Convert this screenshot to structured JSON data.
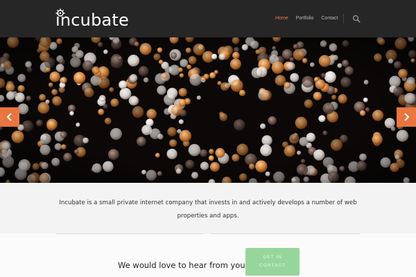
{
  "brand": {
    "name": "incubate"
  },
  "nav": {
    "items": [
      {
        "label": "Home",
        "active": true
      },
      {
        "label": "Portfolio",
        "active": false
      },
      {
        "label": "Contact",
        "active": false
      }
    ],
    "search_icon": "search-icon"
  },
  "hero": {
    "prev_icon": "chevron-left-icon",
    "next_icon": "chevron-right-icon"
  },
  "intro": {
    "text": "Incubate is a small private internet company that invests in and actively develops a number of web properties and apps."
  },
  "contact": {
    "text": "We would love to hear from you...",
    "button_line1": "GET IN",
    "button_line2": "CONTACT"
  },
  "colors": {
    "header_bg": "#262626",
    "accent": "#e9753f",
    "button": "#96d69b"
  }
}
